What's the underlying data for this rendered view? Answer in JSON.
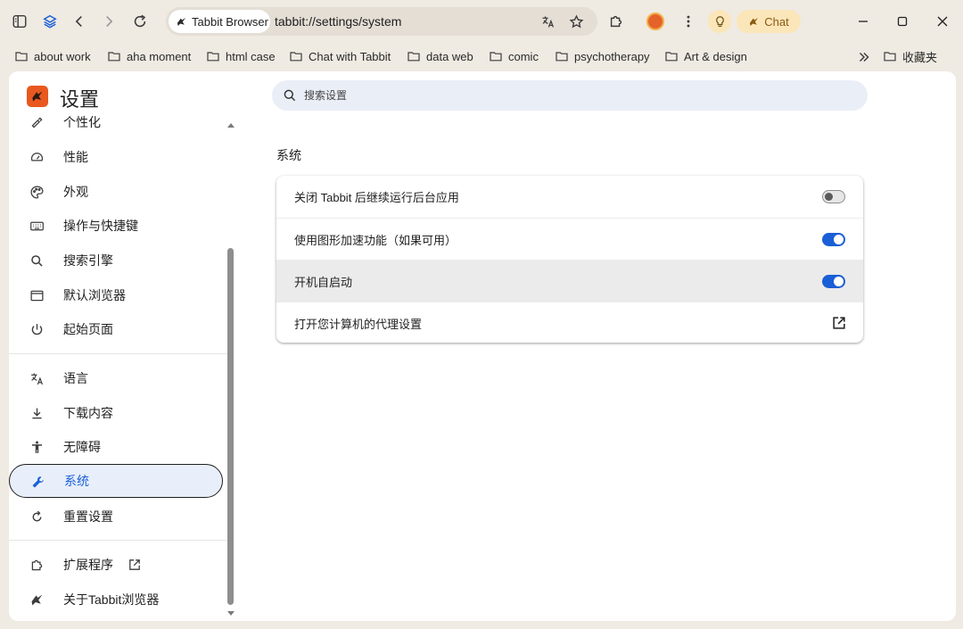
{
  "browser": {
    "site_chip": "Tabbit Browser",
    "url": "tabbit://settings/system",
    "chat_label": "Chat",
    "accent": "#1a5fd6",
    "brand_color": "#e8581f"
  },
  "bookmarks": {
    "items": [
      {
        "label": "about work"
      },
      {
        "label": "aha moment"
      },
      {
        "label": "html case"
      },
      {
        "label": "Chat with Tabbit"
      },
      {
        "label": "data web"
      },
      {
        "label": "comic"
      },
      {
        "label": "psychotherapy"
      },
      {
        "label": "Art & design"
      }
    ],
    "folder_label": "收藏夹"
  },
  "settings": {
    "title": "设置",
    "search_placeholder": "搜索设置"
  },
  "sidebar": {
    "items": [
      {
        "label": "个性化",
        "icon": "brush-icon"
      },
      {
        "label": "性能",
        "icon": "gauge-icon"
      },
      {
        "label": "外观",
        "icon": "palette-icon"
      },
      {
        "label": "操作与快捷键",
        "icon": "keyboard-icon"
      },
      {
        "label": "搜索引擎",
        "icon": "search-icon"
      },
      {
        "label": "默认浏览器",
        "icon": "browser-window-icon"
      },
      {
        "label": "起始页面",
        "icon": "power-icon"
      },
      {
        "label": "语言",
        "icon": "translate-icon"
      },
      {
        "label": "下载内容",
        "icon": "download-icon"
      },
      {
        "label": "无障碍",
        "icon": "accessibility-icon"
      },
      {
        "label": "系统",
        "icon": "wrench-icon",
        "active": true
      },
      {
        "label": "重置设置",
        "icon": "reset-icon"
      },
      {
        "label": "扩展程序",
        "icon": "puzzle-icon"
      },
      {
        "label": "关于Tabbit浏览器",
        "icon": "tabbit-logo-icon"
      }
    ]
  },
  "system": {
    "section_title": "系统",
    "rows": [
      {
        "label": "关闭 Tabbit 后继续运行后台应用",
        "control": "toggle",
        "on": false
      },
      {
        "label": "使用图形加速功能（如果可用）",
        "control": "toggle",
        "on": true
      },
      {
        "label": "开机自启动",
        "control": "toggle",
        "on": true
      },
      {
        "label": "打开您计算机的代理设置",
        "control": "external-link"
      }
    ]
  }
}
